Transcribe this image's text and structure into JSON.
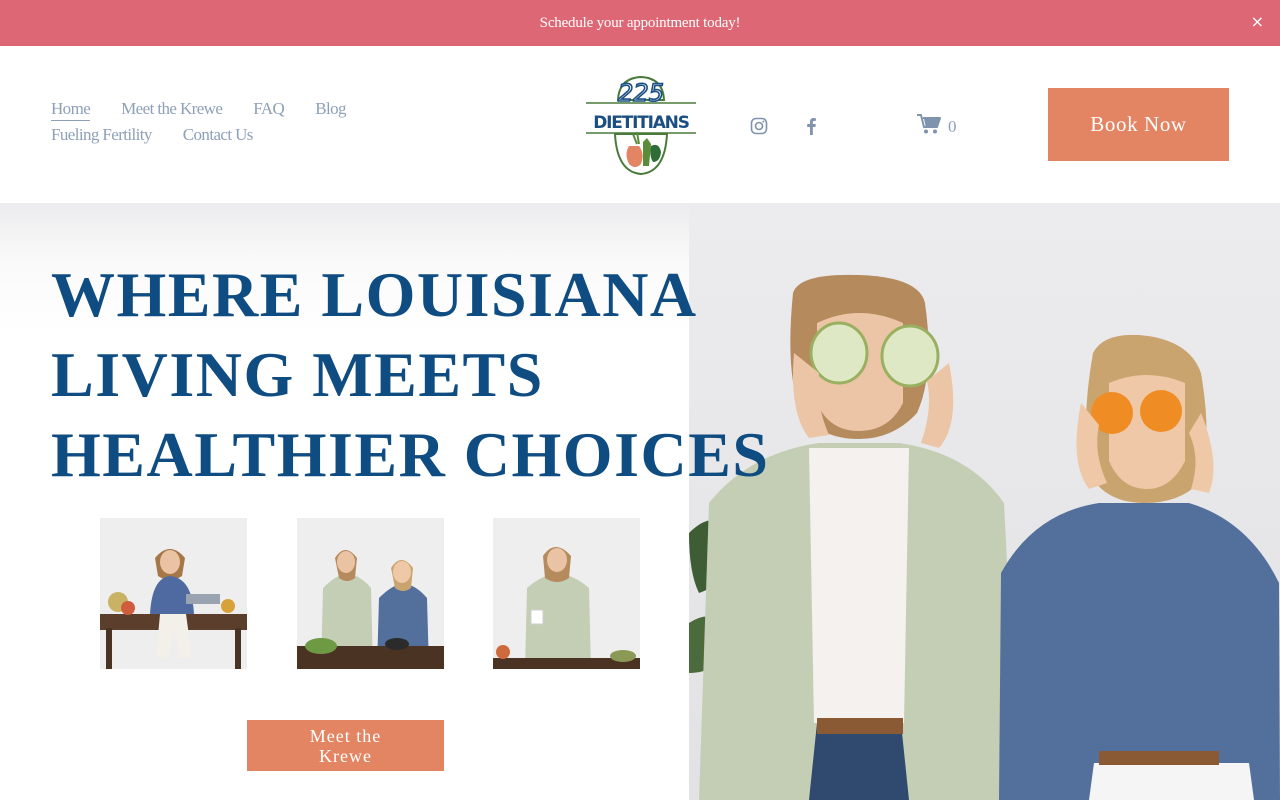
{
  "announcement": {
    "text": "Schedule your appointment today!",
    "close_icon": "close-icon"
  },
  "header": {
    "nav": [
      {
        "label": "Home",
        "active": true
      },
      {
        "label": "Meet the Krewe",
        "active": false
      },
      {
        "label": "FAQ",
        "active": false
      },
      {
        "label": "Blog",
        "active": false
      },
      {
        "label": "Fueling Fertility",
        "active": false
      },
      {
        "label": "Contact Us",
        "active": false
      }
    ],
    "logo": {
      "top": "225",
      "bottom": "DIETITIANS"
    },
    "social": [
      "instagram-icon",
      "facebook-icon"
    ],
    "cart": {
      "icon": "cart-icon",
      "count": "0"
    },
    "book_button": "Book Now"
  },
  "hero": {
    "headline": [
      "WHERE LOUISIANA",
      "LIVING MEETS",
      "HEALTHIER CHOICES"
    ],
    "cta": "Meet the Krewe"
  },
  "colors": {
    "announcement_bg": "#dd6775",
    "accent": "#e38462",
    "headline": "#0f4c81",
    "nav_text": "#8ea0b8"
  }
}
